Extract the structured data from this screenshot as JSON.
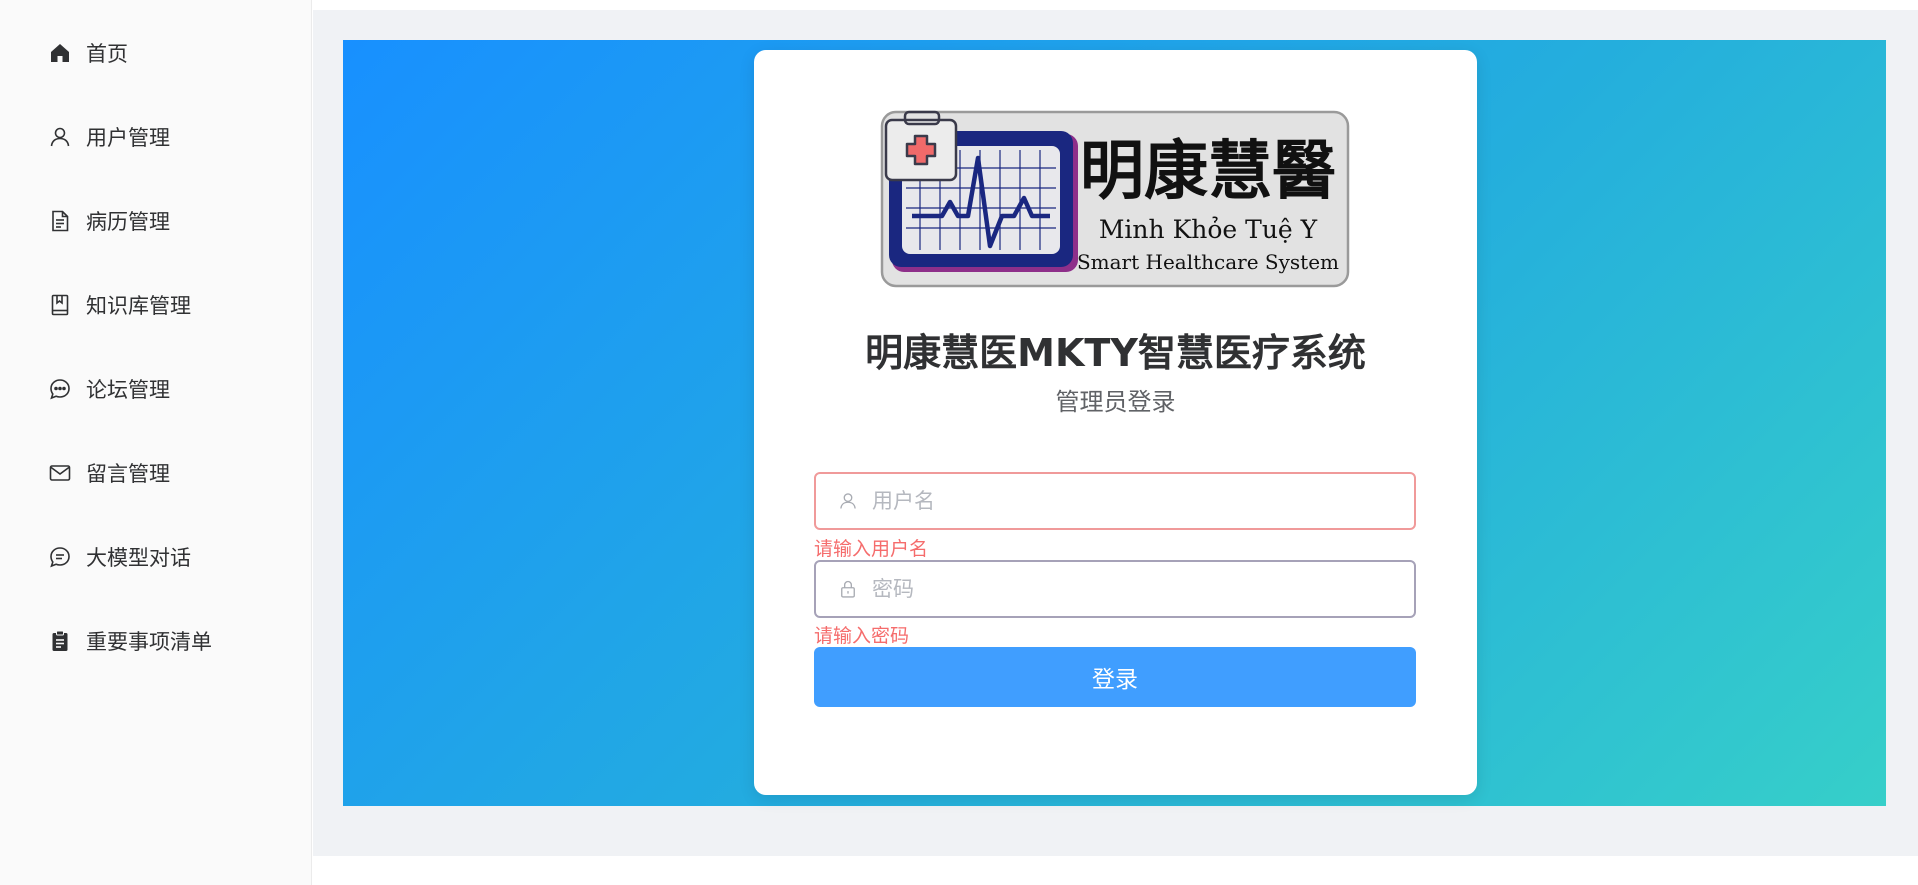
{
  "sidebar": {
    "items": [
      {
        "label": "首页",
        "icon": "home-icon"
      },
      {
        "label": "用户管理",
        "icon": "user-icon"
      },
      {
        "label": "病历管理",
        "icon": "document-icon"
      },
      {
        "label": "知识库管理",
        "icon": "book-icon"
      },
      {
        "label": "论坛管理",
        "icon": "chat-dots-icon"
      },
      {
        "label": "留言管理",
        "icon": "mail-icon"
      },
      {
        "label": "大模型对话",
        "icon": "chat-lines-icon"
      },
      {
        "label": "重要事项清单",
        "icon": "clipboard-icon"
      }
    ]
  },
  "login": {
    "logo": {
      "title_cn": "明康慧醫",
      "title_vi": "Minh Khỏe Tuệ Y",
      "title_en": "Smart Healthcare System"
    },
    "title": "明康慧医MKTY智慧医疗系统",
    "subtitle": "管理员登录",
    "username_placeholder": "用户名",
    "username_value": "",
    "username_error": "请输入用户名",
    "password_placeholder": "密码",
    "password_value": "",
    "password_error": "请输入密码",
    "submit_label": "登录"
  },
  "colors": {
    "primary": "#409eff",
    "error": "#f56c6c",
    "gradient_start": "#1890ff",
    "gradient_end": "#36cfc9"
  }
}
